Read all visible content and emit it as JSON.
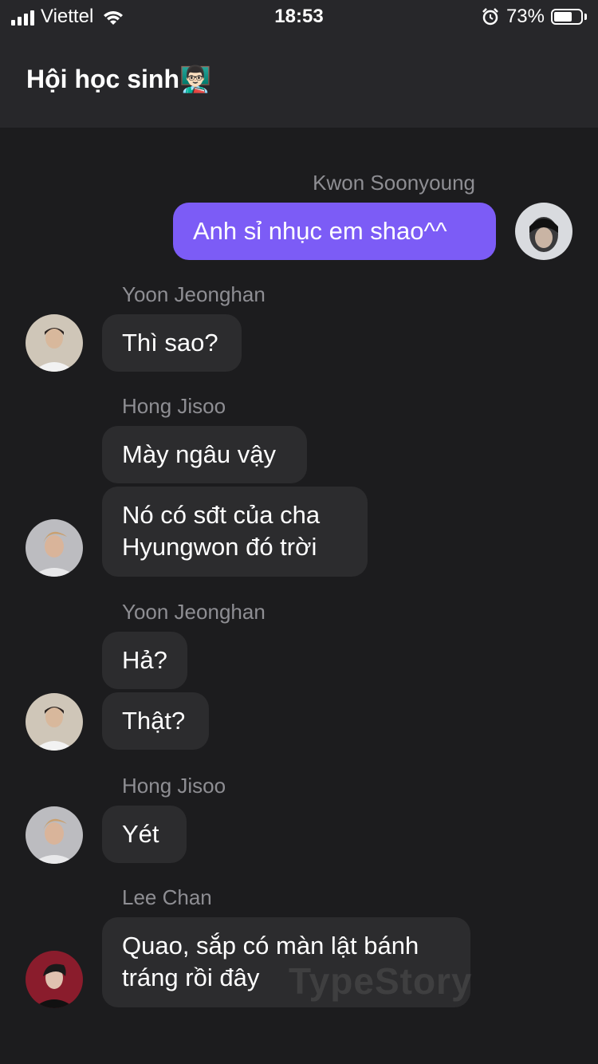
{
  "status_bar": {
    "carrier": "Viettel",
    "time": "18:53",
    "battery_percent": "73%",
    "battery_level": 0.73,
    "icons": [
      "signal-icon",
      "wifi-icon",
      "alarm-icon",
      "battery-icon"
    ]
  },
  "header": {
    "title": "Hội học sinh👨🏻‍🏫"
  },
  "messages": [
    {
      "sender": "Kwon Soonyoung",
      "text": "Anh sỉ nhục em shao^^",
      "outgoing": true
    },
    {
      "sender": "Yoon Jeonghan",
      "text": "Thì sao?"
    },
    {
      "sender": "Hong Jisoo",
      "text": "Mày ngâu vậy"
    },
    {
      "text_line1": "Nó có sđt của cha",
      "text_line2": "Hyungwon đó trời"
    },
    {
      "sender": "Yoon Jeonghan",
      "text": "Hả?"
    },
    {
      "text": "Thật?"
    },
    {
      "sender": "Hong Jisoo",
      "text": "Yét"
    },
    {
      "sender": "Lee Chan",
      "text_line1": "Quao, sắp có màn lật bánh",
      "text_line2": "tráng rồi đây"
    }
  ],
  "watermark": "TypeStory",
  "colors": {
    "background": "#1c1c1e",
    "header": "#27272a",
    "bubble": "#2c2c2e",
    "outgoing_bubble": "#7c5cf6",
    "name_text": "#8e8e93"
  }
}
